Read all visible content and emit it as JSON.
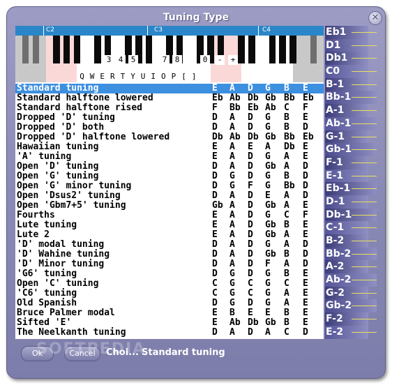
{
  "window": {
    "title": "Tuning Type"
  },
  "keyboard": {
    "octaves": [
      "C2",
      "C3",
      "C4"
    ],
    "number_keys": [
      "3",
      "4",
      "5",
      "7",
      "8",
      "0",
      "-",
      "+"
    ],
    "letter_keys": [
      "Q",
      "W",
      "E",
      "R",
      "T",
      "Y",
      "U",
      "I",
      "O",
      "P",
      "[",
      "]"
    ]
  },
  "tunings": [
    {
      "name": "Standard tuning",
      "notes": [
        "E",
        "A",
        "D",
        "G",
        "B",
        "E"
      ]
    },
    {
      "name": "Standard halftone lowered",
      "notes": [
        "Eb",
        "Ab",
        "Db",
        "Gb",
        "Bb",
        "Eb"
      ]
    },
    {
      "name": "Standard halftone rised",
      "notes": [
        "F",
        "Bb",
        "Eb",
        "Ab",
        "C",
        "F"
      ]
    },
    {
      "name": "Dropped 'D' tuning",
      "notes": [
        "D",
        "A",
        "D",
        "G",
        "B",
        "E"
      ]
    },
    {
      "name": "Dropped 'D' both",
      "notes": [
        "D",
        "A",
        "D",
        "G",
        "B",
        "D"
      ]
    },
    {
      "name": "Dropped 'D' halftone lowered",
      "notes": [
        "Db",
        "Ab",
        "Db",
        "Gb",
        "Bb",
        "Eb"
      ]
    },
    {
      "name": "Hawaiian tuning",
      "notes": [
        "E",
        "A",
        "E",
        "A",
        "Db",
        "E"
      ]
    },
    {
      "name": "'A' tuning",
      "notes": [
        "E",
        "A",
        "D",
        "G",
        "A",
        "E"
      ]
    },
    {
      "name": "Open 'D' tuning",
      "notes": [
        "D",
        "A",
        "D",
        "Gb",
        "A",
        "D"
      ]
    },
    {
      "name": "Open 'G' tuning",
      "notes": [
        "D",
        "G",
        "D",
        "G",
        "B",
        "D"
      ]
    },
    {
      "name": "Open 'G' minor tuning",
      "notes": [
        "D",
        "G",
        "F",
        "G",
        "Bb",
        "D"
      ]
    },
    {
      "name": "Open 'Dsus2' tuning",
      "notes": [
        "D",
        "A",
        "D",
        "E",
        "A",
        "D"
      ]
    },
    {
      "name": "Open 'Gbm7+5' tuning",
      "notes": [
        "Gb",
        "A",
        "D",
        "Gb",
        "A",
        "E"
      ]
    },
    {
      "name": "Fourths",
      "notes": [
        "E",
        "A",
        "D",
        "G",
        "C",
        "F"
      ]
    },
    {
      "name": "Lute tuning",
      "notes": [
        "E",
        "A",
        "D",
        "Gb",
        "B",
        "E"
      ]
    },
    {
      "name": "Lute 2",
      "notes": [
        "E",
        "A",
        "D",
        "Gb",
        "A",
        "E"
      ]
    },
    {
      "name": "'D' modal tuning",
      "notes": [
        "D",
        "A",
        "D",
        "G",
        "A",
        "D"
      ]
    },
    {
      "name": "'D' Wahine tuning",
      "notes": [
        "D",
        "A",
        "D",
        "Gb",
        "B",
        "D"
      ]
    },
    {
      "name": "'D' Minor tuning",
      "notes": [
        "D",
        "A",
        "D",
        "F",
        "A",
        "D"
      ]
    },
    {
      "name": "'G6' tuning",
      "notes": [
        "D",
        "G",
        "D",
        "G",
        "B",
        "E"
      ]
    },
    {
      "name": "Open 'C' tuning",
      "notes": [
        "C",
        "G",
        "C",
        "G",
        "C",
        "E"
      ]
    },
    {
      "name": "'C6' tuning",
      "notes": [
        "C",
        "G",
        "C",
        "G",
        "A",
        "E"
      ]
    },
    {
      "name": "Old Spanish",
      "notes": [
        "D",
        "G",
        "D",
        "G",
        "A",
        "E"
      ]
    },
    {
      "name": "Bruce Palmer modal",
      "notes": [
        "E",
        "B",
        "E",
        "E",
        "B",
        "E"
      ]
    },
    {
      "name": "Sifted 'E'",
      "notes": [
        "E",
        "Ab",
        "Db",
        "Gb",
        "B",
        "E"
      ]
    },
    {
      "name": "The Neelkanth tuning",
      "notes": [
        "D",
        "A",
        "D",
        "A",
        "C",
        "D"
      ]
    }
  ],
  "selected_index": 0,
  "note_scale": [
    "Eb1",
    "D1",
    "Db1",
    "C0",
    "B-1",
    "Bb-1",
    "A-1",
    "Ab-1",
    "G-1",
    "Gb-1",
    "F-1",
    "E-1",
    "Eb-1",
    "D-1",
    "Db-1",
    "C-1",
    "B-2",
    "Bb-2",
    "A-2",
    "Ab-2",
    "G-2",
    "Gb-2",
    "F-2",
    "E-2"
  ],
  "buttons": {
    "ok": "Ok",
    "cancel": "Cancel"
  },
  "status": {
    "label": "Choi...",
    "value": "Standard tuning"
  },
  "watermark": "SOFTPEDIA",
  "colors": {
    "selection": "#3d8fe0",
    "ruler": "#2a86c8",
    "window": "#8a8ab6",
    "scale_line": "#e8e060"
  }
}
